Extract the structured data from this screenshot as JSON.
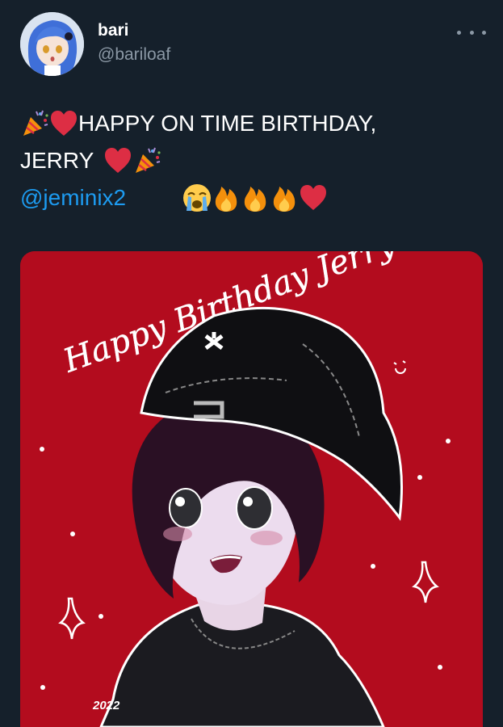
{
  "author": {
    "name": "bari",
    "handle": "@bariloaf"
  },
  "tweet": {
    "line1_text": "HAPPY ON TIME BIRTHDAY,",
    "line2_text": "JERRY",
    "mention": "@jeminix2",
    "emoji": [
      "party-popper",
      "red-heart",
      "red-heart",
      "party-popper",
      "loudly-crying-face",
      "fire",
      "fire",
      "fire",
      "red-heart"
    ]
  },
  "media": {
    "greeting_text": "Happy Birthday Jerry",
    "year_text": "2022",
    "background_color": "#b30c1e"
  },
  "colors": {
    "background": "#15202b",
    "link": "#1d9bf0",
    "secondary_text": "#8b98a5"
  }
}
